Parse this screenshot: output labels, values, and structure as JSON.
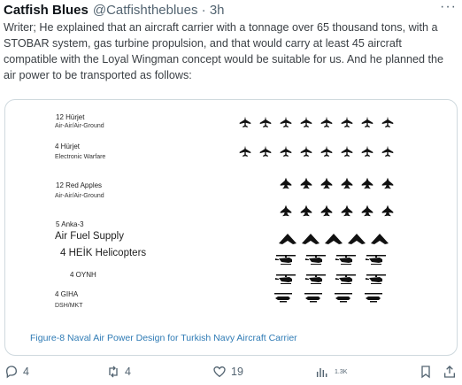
{
  "tweet": {
    "author_name": "Catfish Blues",
    "handle": "@Catfishtheblues",
    "dot": "·",
    "time": "3h",
    "more": "···",
    "text": "Writer; He explained that an aircraft carrier with a tonnage over 65 thousand tons, with a STOBAR system, gas turbine propulsion, and that would carry at least 45 aircraft compatible with the Loyal Wingman concept would be suitable for us. And he planned the air power to be transported as follows:"
  },
  "figure": {
    "groups": [
      {
        "title": "12 Hürjet",
        "sub": "Air-Air/Air-Ground",
        "icon": "jet-icon",
        "count": 16
      },
      {
        "title": "4 Hürjet",
        "sub": "Electronic Warfare",
        "icon": "jet-icon"
      },
      {
        "title": "12 Red Apples",
        "sub": "Air-Air/Air-Ground",
        "icon": "stealth-jet-icon",
        "count": 12
      },
      {
        "title": "5 Anka-3",
        "sub": "Air Fuel Supply",
        "icon": "flying-wing-icon",
        "count": 5
      },
      {
        "title": "4 HEİK Helicopters",
        "icon": "helicopter-icon",
        "count": 4
      },
      {
        "title": "4 OYNH",
        "icon": "helicopter-icon",
        "count": 4
      },
      {
        "title": "4 GIHA",
        "sub": "DSH/MKT",
        "icon": "drone-helicopter-icon",
        "count": 4
      }
    ],
    "caption": "Figure-8 Naval Air Power Design for Turkish Navy Aircraft Carrier"
  },
  "actions": {
    "replies": "4",
    "reposts": "4",
    "likes": "19",
    "views": "1.3K",
    "reply_icon": "reply-icon",
    "repost_icon": "repost-icon",
    "like_icon": "heart-icon",
    "views_icon": "analytics-icon",
    "bookmark_icon": "bookmark-icon",
    "share_icon": "share-icon"
  }
}
